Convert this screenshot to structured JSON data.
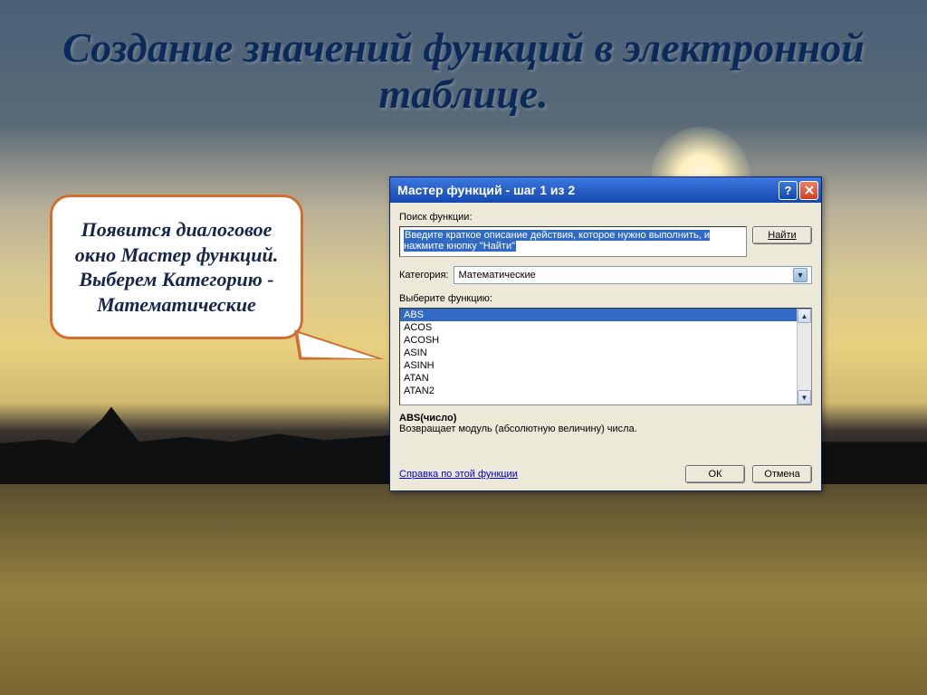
{
  "slide": {
    "title": "Создание значений функций в электронной таблице.",
    "bubble_text": "Появится диалоговое окно Мастер функций. Выберем Категорию - Математические"
  },
  "dialog": {
    "title": "Мастер функций - шаг 1 из 2",
    "search_label": "Поиск функции:",
    "search_text": "Введите краткое описание действия, которое нужно выполнить, и нажмите кнопку \"Найти\"",
    "find_button": "Найти",
    "category_label": "Категория:",
    "category_value": "Математические",
    "select_label": "Выберите функцию:",
    "functions": [
      "ABS",
      "ACOS",
      "ACOSH",
      "ASIN",
      "ASINH",
      "ATAN",
      "ATAN2"
    ],
    "selected_index": 0,
    "desc_sig": "ABS(число)",
    "desc_text": "Возвращает модуль (абсолютную величину) числа.",
    "help_link": "Справка по этой функции",
    "ok": "ОК",
    "cancel": "Отмена"
  }
}
